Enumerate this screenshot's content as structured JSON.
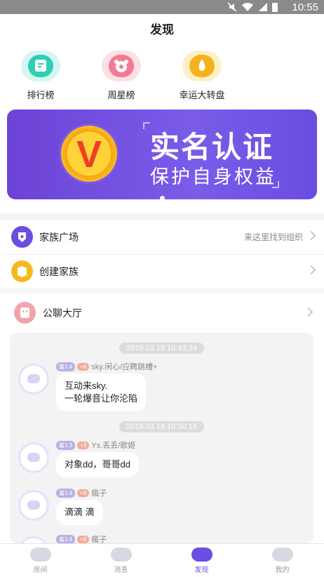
{
  "status_bar": {
    "time": "10:55"
  },
  "header": {
    "title": "发现"
  },
  "shortcuts": [
    {
      "label": "排行榜",
      "icon": "ranking-icon",
      "color": "#2ecfb4"
    },
    {
      "label": "周星榜",
      "icon": "weekly-star-icon",
      "color": "#f37a93"
    },
    {
      "label": "幸运大转盘",
      "icon": "lucky-wheel-icon",
      "color": "#f6b21d"
    }
  ],
  "banner": {
    "coin_letter": "V",
    "title": "实名认证",
    "subtitle": "保护自身权益"
  },
  "family_square": {
    "label": "家族广场",
    "hint": "来这里找到组织",
    "color": "#6b4de0"
  },
  "create_family": {
    "label": "创建家族",
    "color": "#f6b81f"
  },
  "public_hall": {
    "label": "公聊大厅"
  },
  "chat": {
    "timestamps": [
      "2019.03.18 10:43:24",
      "2019.03.18 10:50:15"
    ],
    "messages": [
      {
        "level": "富1:4",
        "heart": "+6",
        "name": "sky.闲心/应聘跳槽+",
        "text": "互动来sky.\n一轮爆音让你沦陷"
      },
      {
        "level": "富1:3",
        "heart": "+3",
        "name": "Ys.丢丢/歌姬",
        "text": "对象dd，哥哥dd"
      },
      {
        "level": "富1:4",
        "heart": "+8",
        "name": "瘋子",
        "text": "滴滴 滴"
      },
      {
        "level": "富1:4",
        "heart": "+8",
        "name": "瘋子",
        "text": ""
      }
    ]
  },
  "tabs": [
    {
      "label": "房间",
      "active": false
    },
    {
      "label": "消息",
      "active": false
    },
    {
      "label": "发现",
      "active": true
    },
    {
      "label": "我的",
      "active": false
    }
  ]
}
